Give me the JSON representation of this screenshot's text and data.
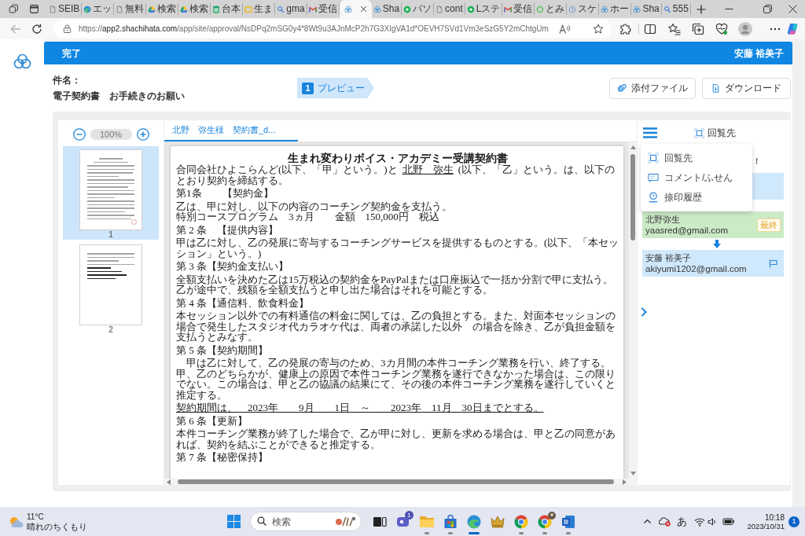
{
  "browser": {
    "tabs": [
      {
        "kind": "page",
        "title": "SEIB",
        "selected": false
      },
      {
        "kind": "edge",
        "title": "エッ",
        "selected": false
      },
      {
        "kind": "page",
        "title": "無料",
        "selected": false
      },
      {
        "kind": "drive",
        "title": "検索",
        "selected": false
      },
      {
        "kind": "drive",
        "title": "検索",
        "selected": false
      },
      {
        "kind": "sheets",
        "title": "台本",
        "selected": false
      },
      {
        "kind": "slides",
        "title": "生ま",
        "selected": false
      },
      {
        "kind": "search",
        "title": "gma",
        "selected": false
      },
      {
        "kind": "gmail",
        "title": "受信",
        "selected": false
      },
      {
        "kind": "cloud",
        "selected": true
      },
      {
        "kind": "cloud",
        "title": "Sha",
        "selected": false
      },
      {
        "kind": "green",
        "title": "パソ",
        "selected": false
      },
      {
        "kind": "page",
        "title": "cont",
        "selected": false
      },
      {
        "kind": "green",
        "title": "Lステ",
        "selected": false
      },
      {
        "kind": "gmail",
        "title": "受信",
        "selected": false
      },
      {
        "kind": "ring",
        "title": "とみ",
        "selected": false
      },
      {
        "kind": "clock",
        "title": "スケ",
        "selected": false
      },
      {
        "kind": "cloud",
        "title": "ホー",
        "selected": false
      },
      {
        "kind": "cloud",
        "title": "Sha",
        "selected": false
      },
      {
        "kind": "search",
        "title": "555",
        "selected": false
      }
    ],
    "address": {
      "scheme": "https://",
      "host": "app2.shachihata.com",
      "path": "/app/site/approval/NsDPq2mSG0y4*8Wt9u3AJnMcP2h7G3XIgVA1d*OEVH7SVd1Vm3eSzG5Y2mChtgUm"
    }
  },
  "header": {
    "status": "完了",
    "user": "安藤 裕美子"
  },
  "subject": {
    "label": "件名：",
    "title": "電子契約書　お手続きのお願い"
  },
  "steps": [
    {
      "number": "1",
      "label": "プレビュー",
      "selected": true
    }
  ],
  "actions": [
    {
      "kind": "paperclip",
      "label": "添付ファイル"
    },
    {
      "kind": "download",
      "label": "ダウンロード"
    }
  ],
  "thumbnails": {
    "zoom": "100%",
    "pages": [
      {
        "label": "1",
        "selected": true
      },
      {
        "label": "2",
        "selected": false
      }
    ]
  },
  "document": {
    "tabs": [
      {
        "label": "北野　弥生様　契約書_d...",
        "selected": true
      }
    ],
    "title": "生まれ変わりボイス・アカデミー受講契約書",
    "blocks": [
      {
        "kind": "party",
        "before": "合同会社ひよこらんど(以下、「甲」という。)と",
        "name": "北野　弥生",
        "after": "(以下、「乙」という。は、以下のとおり契約を締結する。"
      },
      {
        "kind": "heading",
        "text": "第1条　　【契約金】"
      },
      {
        "kind": "para",
        "lines": [
          "乙は、甲に対し、以下の内容のコーチング契約金を支払う。",
          "特別コースプログラム　3ヵ月　　金額　150,000円　税込"
        ]
      },
      {
        "kind": "heading",
        "text": "第 2 条　【提供内容】"
      },
      {
        "kind": "para",
        "lines": [
          "甲は乙に対し、乙の発展に寄与するコーチングサービスを提供するものとする。(以下、「本セッション」という。)"
        ]
      },
      {
        "kind": "heading",
        "text": "第 3 条【契約金支払い】"
      },
      {
        "kind": "para",
        "lines": [
          "全額支払いを決めた乙は15万税込の契約金をPayPalまたは口座振込で一括か分割で甲に支払う。乙が途中で、残額を全額支払うと申し出た場合はそれを可能とする。"
        ]
      },
      {
        "kind": "heading",
        "text": "第 4 条【通信料、飲食料金】"
      },
      {
        "kind": "para",
        "lines": [
          "本セッション以外での有料通信の料金に関しては、乙の負担とする。また、対面本セッションの場合で発生したスタジオ代カラオケ代は、両者の承諾した以外　の場合を除き、乙が負担金額を支払うとみなす。"
        ]
      },
      {
        "kind": "heading",
        "text": "第 5 条【契約期間】"
      },
      {
        "kind": "para",
        "lines": [
          "　甲は乙に対して、乙の発展の寄与のため、3カ月間の本件コーチング業務を行い、終了する。甲、乙のどちらかが、健康上の原因で本件コーチング業務を遂行できなかった場合は、この限りでない。この場合は、甲と乙の協議の結果にて、その後の本件コーチング業務を遂行していくと推定する。"
        ]
      },
      {
        "kind": "period",
        "text": "契約期間は、　2023年　　9月　　1日　～　　2023年　11月　30日までとする。"
      },
      {
        "kind": "heading",
        "text": "第 6 条【更新】"
      },
      {
        "kind": "para",
        "lines": [
          "本件コーチング業務が終了した場合で、乙が甲に対し、更新を求める場合は、甲と乙の同意があれば、契約を結ぶことができると推定する。"
        ]
      },
      {
        "kind": "heading",
        "text": "第 7 条【秘密保持】"
      }
    ]
  },
  "circulation": {
    "title": "回覧先",
    "menu": [
      {
        "kind": "route",
        "label": "回覧先"
      },
      {
        "kind": "comment",
        "label": "コメント/ふせん"
      },
      {
        "kind": "stamp",
        "label": "捺印履歴"
      }
    ],
    "partial_text": "f",
    "entries": [
      {
        "color": "#d0e8fb",
        "arrow_before": false,
        "flag": false
      },
      {
        "name": "北野弥生",
        "email": "yaasred@gmail.com",
        "badge": "最終",
        "color": "#cbeac6",
        "arrow_before": false,
        "flag": false
      },
      {
        "name": "安藤 裕美子",
        "email": "akiyumi1202@gmail.com",
        "color": "#d0e8fb",
        "arrow_before": true,
        "flag": true
      }
    ]
  },
  "taskbar": {
    "weather": {
      "temperature": "11°C",
      "condition": "晴れのちくもり"
    },
    "search": {
      "placeholder": "検索"
    },
    "apps": [
      {
        "kind": "taskview",
        "running": false,
        "active": false,
        "profile": false
      },
      {
        "kind": "chat",
        "badge": "1",
        "running": false,
        "active": false,
        "profile": false
      },
      {
        "kind": "folder",
        "running": true,
        "active": false,
        "profile": false
      },
      {
        "kind": "store",
        "running": true,
        "active": false,
        "profile": false
      },
      {
        "kind": "edge",
        "running": true,
        "active": true,
        "profile": false
      },
      {
        "kind": "crown",
        "running": false,
        "active": false,
        "profile": false
      },
      {
        "kind": "chrome",
        "running": true,
        "active": false,
        "profile": false
      },
      {
        "kind": "chrome",
        "running": true,
        "active": false,
        "profile": true
      },
      {
        "kind": "word",
        "running": true,
        "active": false,
        "profile": false
      }
    ],
    "tray": {
      "ime": "あ",
      "time": "10:18",
      "date": "2023/10/31",
      "notifications": "1"
    }
  }
}
